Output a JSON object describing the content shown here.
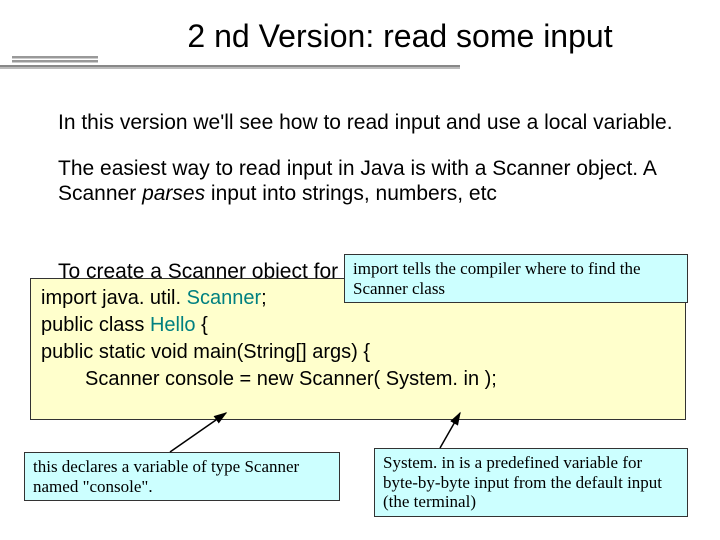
{
  "title": "2 nd Version: read some input",
  "para1": "In this version we'll see how to read input and use a local variable.",
  "para2_pre": "The easiest way to read input in Java is with a Scanner object.  A Scanner ",
  "para2_em": "parses",
  "para2_post": " input into strings, numbers, etc",
  "hidden_line": "To create a Scanner object for",
  "code": {
    "l1_pre": "import java. util. ",
    "l1_cls": "Scanner",
    "l1_post": ";",
    "l2_pre": "public class ",
    "l2_cls": "Hello",
    "l2_post": " {",
    "l3": "public static void main(String[] args) {",
    "l4": "Scanner console = new Scanner( System. in );"
  },
  "callouts": {
    "top": "import tells the compiler where to find the Scanner class",
    "bl": "this declares a variable of type Scanner named \"console\".",
    "br": "System. in is a predefined variable for byte-by-byte input from the default input (the terminal)"
  }
}
